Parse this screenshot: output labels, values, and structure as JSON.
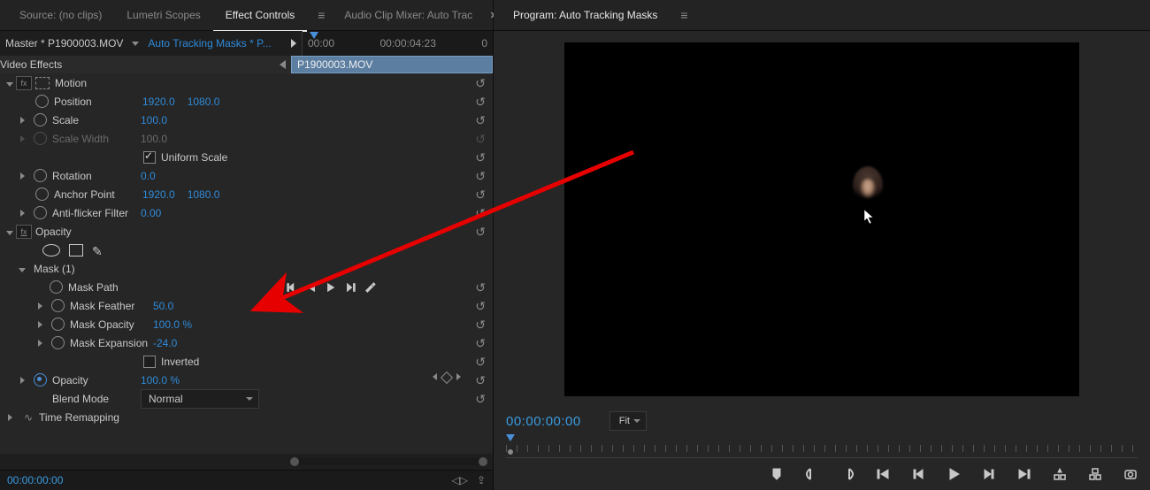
{
  "tabs_left": {
    "source": "Source: (no clips)",
    "lumetri": "Lumetri Scopes",
    "effect": "Effect Controls",
    "mixer": "Audio Clip Mixer: Auto Trac"
  },
  "tabs_right": {
    "program": "Program: Auto Tracking Masks"
  },
  "master": {
    "clip": "Master * P1900003.MOV",
    "seq": "Auto Tracking Masks * P..."
  },
  "mini_ruler": {
    "t0": "00:00",
    "t1": "00:00:04:23",
    "t2": "0"
  },
  "mini_clip": "P1900003.MOV",
  "sections": {
    "video_effects": "Video Effects",
    "motion": "Motion",
    "opacity": "Opacity",
    "mask": "Mask (1)",
    "time_remap": "Time Remapping"
  },
  "props": {
    "position": {
      "label": "Position",
      "x": "1920.0",
      "y": "1080.0"
    },
    "scale": {
      "label": "Scale",
      "v": "100.0"
    },
    "scale_width": {
      "label": "Scale Width",
      "v": "100.0"
    },
    "uniform": {
      "label": "Uniform Scale"
    },
    "rotation": {
      "label": "Rotation",
      "v": "0.0"
    },
    "anchor": {
      "label": "Anchor Point",
      "x": "1920.0",
      "y": "1080.0"
    },
    "antiflicker": {
      "label": "Anti-flicker Filter",
      "v": "0.00"
    },
    "mask_path": {
      "label": "Mask Path"
    },
    "mask_feather": {
      "label": "Mask Feather",
      "v": "50.0"
    },
    "mask_opacity": {
      "label": "Mask Opacity",
      "v": "100.0 %"
    },
    "mask_expansion": {
      "label": "Mask Expansion",
      "v": "-24.0"
    },
    "inverted": {
      "label": "Inverted"
    },
    "opacity_prop": {
      "label": "Opacity",
      "v": "100.0 %"
    },
    "blend": {
      "label": "Blend Mode",
      "v": "Normal"
    }
  },
  "status": {
    "tc": "00:00:00:00"
  },
  "program": {
    "tc": "00:00:00:00",
    "fit": "Fit"
  }
}
